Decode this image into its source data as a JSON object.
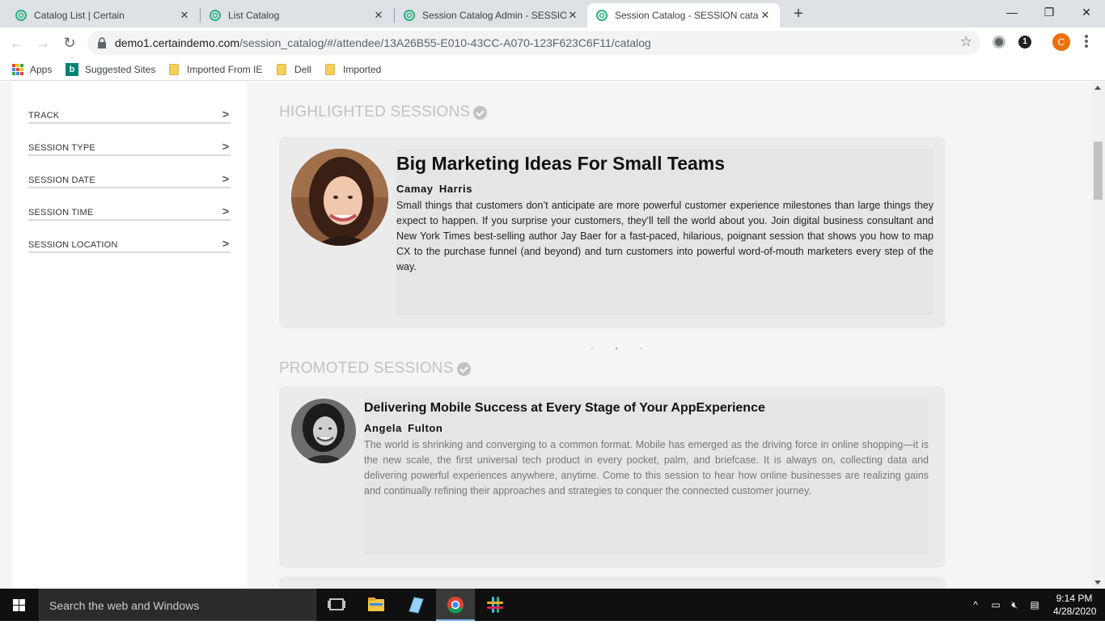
{
  "browser": {
    "tabs": [
      {
        "title": "Catalog List | Certain",
        "active": false
      },
      {
        "title": "List Catalog",
        "active": false
      },
      {
        "title": "Session Catalog Admin - SESSION",
        "active": false
      },
      {
        "title": "Session Catalog - SESSION catalo",
        "active": true
      }
    ],
    "new_tab": "+",
    "window_controls": {
      "minimize": "—",
      "maximize": "❐",
      "close": "✕"
    },
    "url_host": "demo1.certaindemo.com",
    "url_path": "/session_catalog/#/attendee/13A26B55-E010-43CC-A070-123F623C6F11/catalog",
    "profile_initial": "C",
    "extension_badge": "1",
    "bookmarks": [
      {
        "label": "Apps",
        "icon": "apps-grid-icon"
      },
      {
        "label": "Suggested Sites",
        "icon": "bing-icon"
      },
      {
        "label": "Imported From IE",
        "icon": "folder-icon"
      },
      {
        "label": "Dell",
        "icon": "folder-icon"
      },
      {
        "label": "Imported",
        "icon": "folder-icon"
      }
    ],
    "accent_color": "#e8710a"
  },
  "sidebar": {
    "filters": [
      {
        "label": "TRACK"
      },
      {
        "label": "SESSION TYPE"
      },
      {
        "label": "SESSION DATE"
      },
      {
        "label": "SESSION TIME"
      },
      {
        "label": "SESSION LOCATION"
      }
    ]
  },
  "highlighted": {
    "heading": "HIGHLIGHTED SESSIONS",
    "session": {
      "title": "Big Marketing Ideas For Small Teams",
      "speaker": "Camay Harris",
      "description": "Small things that customers don’t anticipate are more powerful customer experience milestones than large things they expect to happen. If you surprise your customers, they’ll tell the world about you. Join digital business consultant and New York Times best-selling author Jay Baer for a fast-paced, hilarious, poignant session that shows you how to map CX to the purchase funnel (and beyond) and turn customers into powerful word-of-mouth marketers every step of the way."
    }
  },
  "promoted": {
    "heading": "PROMOTED SESSIONS",
    "session": {
      "title": "Delivering Mobile Success at Every Stage of Your AppExperience",
      "speaker": "Angela Fulton",
      "description": "The world is shrinking and converging to a common format. Mobile has emerged as the driving force in online shopping—it is the new scale, the first universal tech product in every pocket, palm, and briefcase. It is always on, collecting data and delivering powerful experiences anywhere, anytime. Come to this session to hear how online businesses are realizing gains and continually refining their approaches and strategies to conquer the connected customer journey."
    }
  },
  "taskbar": {
    "search_placeholder": "Search the web and Windows",
    "time": "9:14 PM",
    "date": "4/28/2020"
  }
}
